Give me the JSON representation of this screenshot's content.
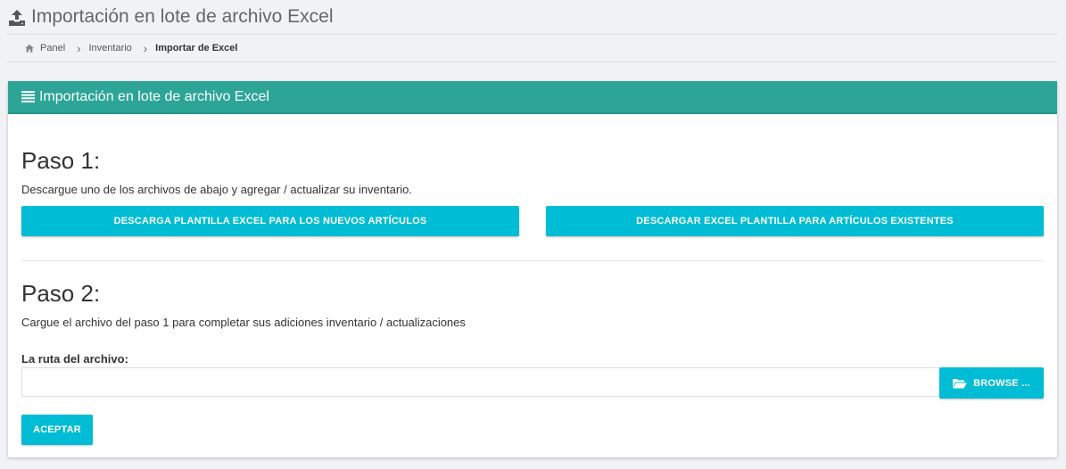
{
  "header": {
    "title": "Importación en lote de archivo Excel",
    "icon": "upload-icon"
  },
  "breadcrumb": {
    "items": [
      "Panel",
      "Inventario",
      "Importar de Excel"
    ],
    "home_icon": "home-icon",
    "separator_icon": "chevron-right-icon"
  },
  "panel": {
    "title": "Importación en lote de archivo Excel",
    "icon": "list-icon",
    "header_color": "#2ca597"
  },
  "step1": {
    "title": "Paso 1:",
    "description": "Descargue uno de los archivos de abajo y agregar / actualizar su inventario.",
    "btn_new": "DESCARGA PLANTILLA EXCEL PARA LOS NUEVOS ARTÍCULOS",
    "btn_existing": "DESCARGAR EXCEL PLANTILLA PARA ARTÍCULOS EXISTENTES"
  },
  "step2": {
    "title": "Paso 2:",
    "description": "Cargue el archivo del paso 1 para completar sus adiciones inventario / actualizaciones",
    "file_label": "La ruta del archivo:",
    "file_value": "",
    "browse_label": "BROWSE ...",
    "browse_icon": "folder-open-icon",
    "submit_label": "ACEPTAR"
  },
  "colors": {
    "accent": "#00bcd4",
    "panel_header": "#2ca597",
    "background": "#f1f2f6"
  }
}
